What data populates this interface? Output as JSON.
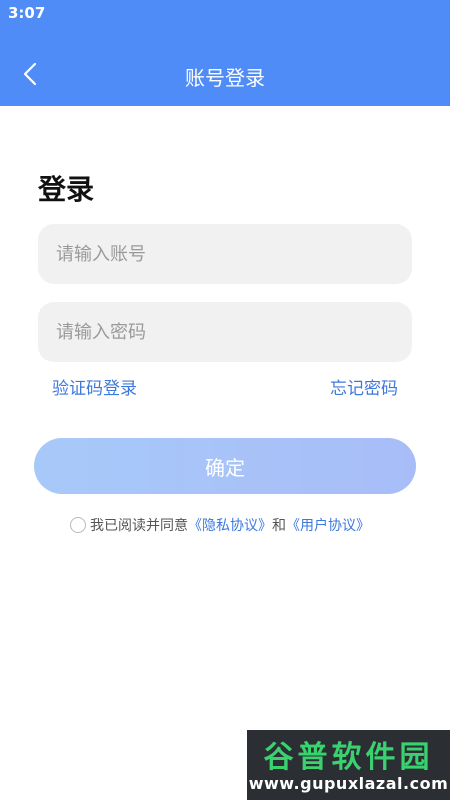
{
  "status_bar": {
    "time": "3:07"
  },
  "header": {
    "title": "账号登录",
    "back_icon": "chevron-left-icon"
  },
  "main": {
    "heading": "登录",
    "account_placeholder": "请输入账号",
    "password_placeholder": "请输入密码",
    "sms_login_link": "验证码登录",
    "forgot_password_link": "忘记密码",
    "confirm_button": "确定",
    "agreement": {
      "prefix": "我已阅读并同意",
      "privacy_link": "《隐私协议》",
      "and": "和",
      "user_link": "《用户协议》"
    }
  },
  "watermark": {
    "name": "谷普软件园",
    "url": "www.gupuxlazal.com"
  },
  "colors": {
    "header_bg": "#4f8cf7",
    "link": "#3d78de",
    "button_gradient_start": "#a7c9f9",
    "button_gradient_end": "#a8bdf8",
    "input_bg": "#f1f1f1"
  }
}
